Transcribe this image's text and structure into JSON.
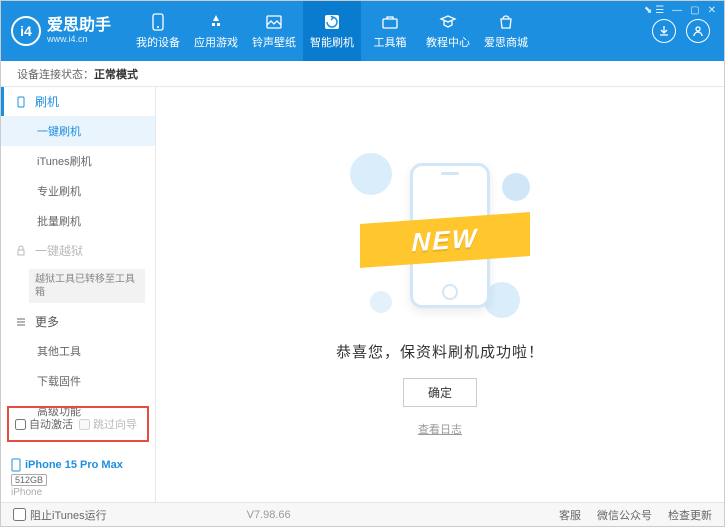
{
  "header": {
    "app_name": "爱思助手",
    "app_url": "www.i4.cn",
    "nav": [
      {
        "label": "我的设备"
      },
      {
        "label": "应用游戏"
      },
      {
        "label": "铃声壁纸"
      },
      {
        "label": "智能刷机"
      },
      {
        "label": "工具箱"
      },
      {
        "label": "教程中心"
      },
      {
        "label": "爱思商城"
      }
    ]
  },
  "status": {
    "label": "设备连接状态：",
    "value": "正常模式"
  },
  "sidebar": {
    "flash": {
      "head": "刷机",
      "items": [
        "一键刷机",
        "iTunes刷机",
        "专业刷机",
        "批量刷机"
      ]
    },
    "jailbreak": {
      "head": "一键越狱",
      "note": "越狱工具已转移至工具箱"
    },
    "more": {
      "head": "更多",
      "items": [
        "其他工具",
        "下载固件",
        "高级功能"
      ]
    },
    "checks": {
      "auto_activate": "自动激活",
      "skip_guide": "跳过向导"
    },
    "device": {
      "name": "iPhone 15 Pro Max",
      "storage": "512GB",
      "type": "iPhone"
    }
  },
  "main": {
    "banner": "NEW",
    "message": "恭喜您，保资料刷机成功啦！",
    "ok": "确定",
    "log_link": "查看日志"
  },
  "footer": {
    "block_itunes": "阻止iTunes运行",
    "version": "V7.98.66",
    "links": [
      "客服",
      "微信公众号",
      "检查更新"
    ]
  }
}
